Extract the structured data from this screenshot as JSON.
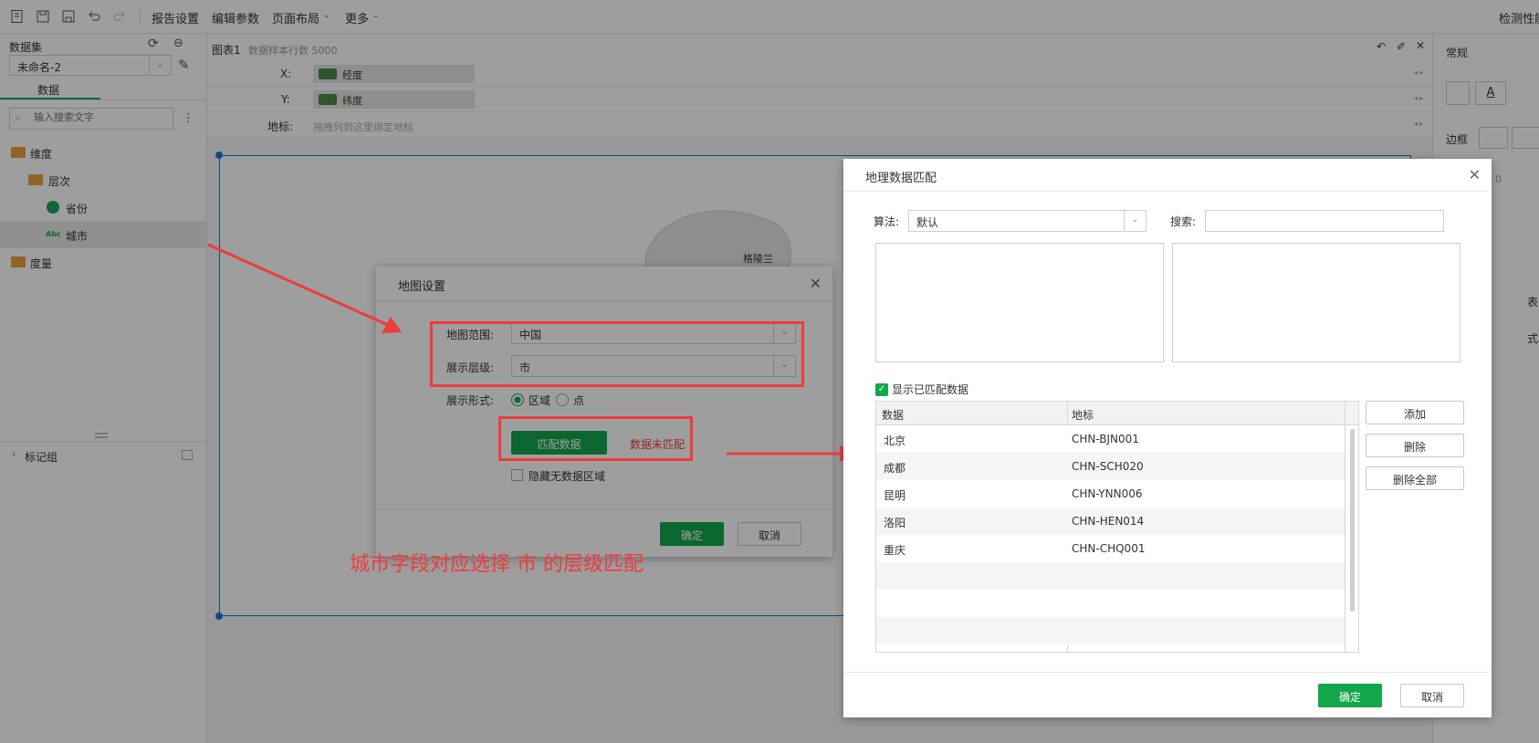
{
  "toolbar": {
    "menus": [
      "报告设置",
      "编辑参数",
      "页面布局",
      "更多"
    ],
    "right_label": "检测性能"
  },
  "left_panel": {
    "dataset_label": "数据集",
    "dataset_value": "未命名-2",
    "tab_data": "数据",
    "search_placeholder": "输入搜索文字",
    "tree": {
      "dimension": "维度",
      "hierarchy": "层次",
      "province": "省份",
      "city": "城市",
      "measure": "度量"
    },
    "mark_group": "标记组"
  },
  "canvas": {
    "chart_title": "图表1",
    "sample_rows": "数据样本行数 5000",
    "x_label": "X:",
    "x_field": "经度",
    "y_label": "Y:",
    "y_field": "纬度",
    "geo_label": "地标:",
    "geo_placeholder": "拖拽列到这里绑定地标",
    "map_label": "格陵兰"
  },
  "right_panel": {
    "section_general": "常规",
    "border_label": "边框",
    "zero_value": "0",
    "label_a": "表",
    "label_b": "式"
  },
  "map_settings_dialog": {
    "title": "地图设置",
    "range_label": "地图范围:",
    "range_value": "中国",
    "level_label": "展示层级:",
    "level_value": "市",
    "form_label": "展示形式:",
    "form_option_area": "区域",
    "form_option_point": "点",
    "match_button": "匹配数据",
    "match_status": "数据未匹配",
    "hide_nodata": "隐藏无数据区域",
    "ok": "确定",
    "cancel": "取消"
  },
  "annotation_text": "城市字段对应选择 市 的层级匹配",
  "geo_match_dialog": {
    "title": "地理数据匹配",
    "algorithm_label": "算法:",
    "algorithm_value": "默认",
    "search_label": "搜索:",
    "show_matched": "显示已匹配数据",
    "col_data": "数据",
    "col_geo": "地标",
    "rows": [
      {
        "data": "北京",
        "geo": "CHN-BJN001"
      },
      {
        "data": "成都",
        "geo": "CHN-SCH020"
      },
      {
        "data": "昆明",
        "geo": "CHN-YNN006"
      },
      {
        "data": "洛阳",
        "geo": "CHN-HEN014"
      },
      {
        "data": "重庆",
        "geo": "CHN-CHQ001"
      }
    ],
    "add": "添加",
    "delete": "删除",
    "delete_all": "删除全部",
    "ok": "确定",
    "cancel": "取消"
  },
  "colors": {
    "accent_green": "#13a74b",
    "annotation_red": "#ef3b3b",
    "selection_blue": "#1976d2"
  }
}
